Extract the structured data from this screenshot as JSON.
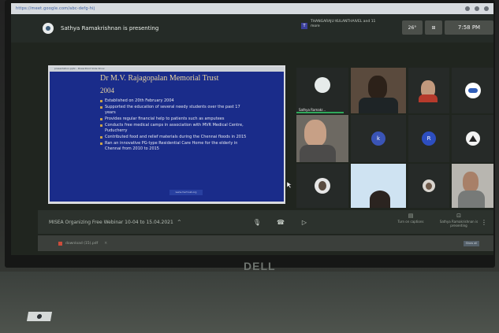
{
  "browser": {
    "url": "https://meet.google.com/abc-defg-hij"
  },
  "topbar": {
    "presenter_text": "Sathya Ramakrishnan is presenting",
    "speaker_badge": "T",
    "speaking_text": "THANGARAJU KULANTHAIVEL and 11 more",
    "temp": "26°",
    "time": "7:58 PM"
  },
  "slide": {
    "chrome": "presentation.pptx - PowerPoint Slide Show",
    "title": "Dr M.V. Rajagopalan Memorial Trust",
    "year": "2004",
    "bullets": [
      "Established on 20th February 2004",
      "Supported the education of several needy students over the past 17 years",
      "Provides regular financial help to patients such as amputees",
      "Conducts free medical camps in association with MVR Medical Centre, Puducherry",
      "Contributed food and relief materials during the Chennai floods in 2015",
      "Ran an innovative PG-type Residential Care Home for the elderly in Chennai from 2010 to 2015"
    ],
    "footer": "www.mvrtrust.org"
  },
  "participants": {
    "presenter_label": "Sathya Ramakr...",
    "k_initial": "k",
    "r_initial": "R"
  },
  "controls": {
    "meeting_name": "MISEA Organizing Free Webinar 10-04 to 15.04.2021",
    "chevron": "^",
    "mic": "🎙",
    "hangup": "☎",
    "present": "▷",
    "pin_label": "Turn on captions",
    "present_label": "Sathya Ramakrishnan is presenting",
    "more": "⋮"
  },
  "taskbar": {
    "file": "download (15).pdf",
    "close": "×",
    "show_all": "Show all"
  },
  "laptop": {
    "brand": "DELL"
  },
  "colors": {
    "slide_bg": "#1a2c8a",
    "slide_title": "#e8d4a0",
    "active_speaker": "#2fa85b"
  }
}
